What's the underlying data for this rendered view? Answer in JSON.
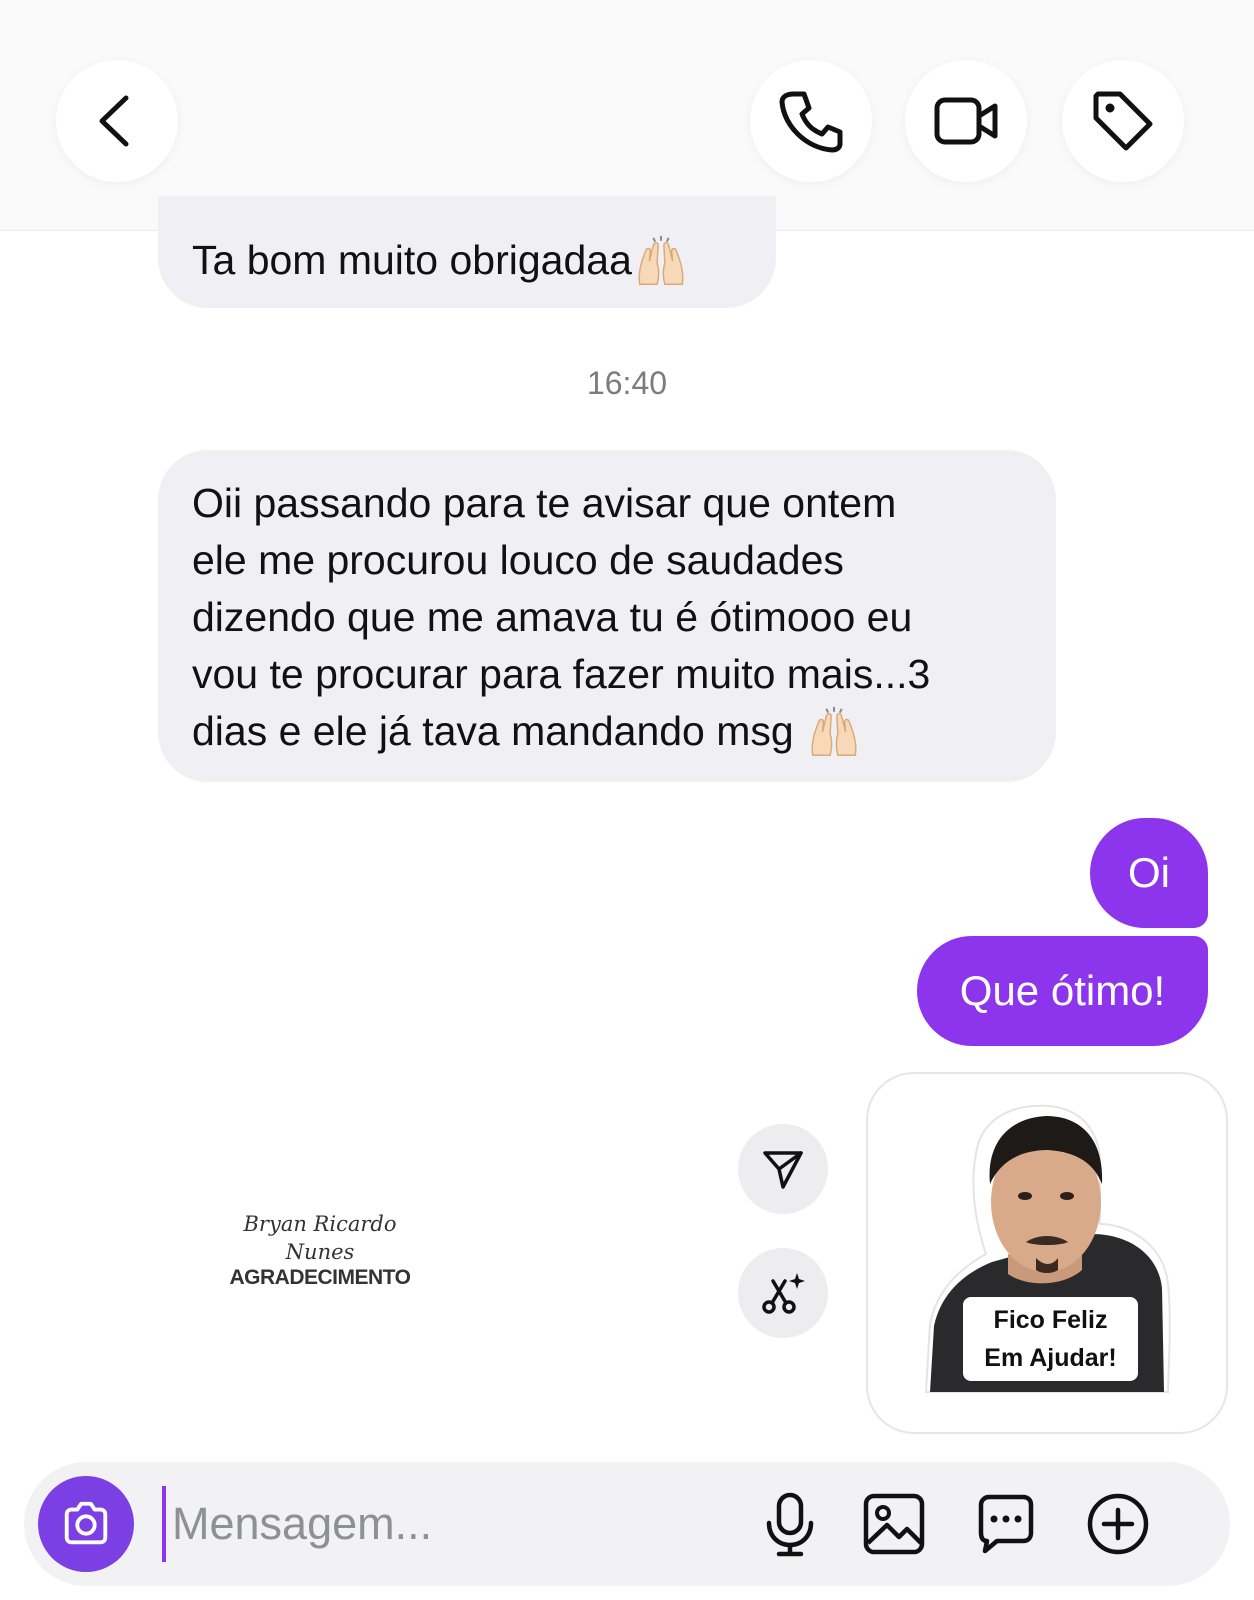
{
  "header": {
    "back_icon": "chevron-left-icon",
    "actions": [
      {
        "name": "call-button",
        "icon": "phone-icon"
      },
      {
        "name": "video-call-button",
        "icon": "video-camera-icon"
      },
      {
        "name": "tag-button",
        "icon": "tag-icon"
      }
    ]
  },
  "messages": {
    "received_1": "Ta bom muito obrigadaa",
    "timestamp": "16:40",
    "received_2_lines": [
      "Oii passando para te avisar que ontem",
      "ele me procurou louco de saudades",
      "dizendo que me amava tu é ótimooo eu",
      "vou te procurar para fazer muito mais...3",
      "dias e ele já tava mandando msg"
    ],
    "sent_1": "Oi",
    "sent_2": "Que ótimo!"
  },
  "sticker": {
    "line1": "Fico Feliz",
    "line2": "Em Ajudar!"
  },
  "watermark": {
    "line1": "Bryan Ricardo",
    "line2": "Nunes",
    "line3": "AGRADECIMENTO"
  },
  "side_actions": [
    {
      "name": "share-button",
      "icon": "send-icon"
    },
    {
      "name": "remix-button",
      "icon": "scissors-sparkle-icon"
    }
  ],
  "composer": {
    "placeholder": "Mensagem...",
    "icons": [
      "camera-icon",
      "microphone-icon",
      "image-icon",
      "sticker-chat-icon",
      "plus-icon"
    ]
  },
  "colors": {
    "accent": "#8c35ec",
    "camera": "#7b3fe4",
    "bubble_in": "#efeff4",
    "timestamp": "#7b7b80"
  }
}
